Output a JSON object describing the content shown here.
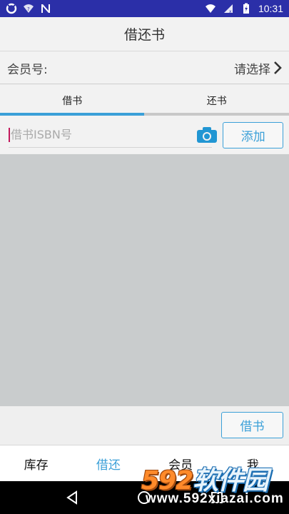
{
  "status_bar": {
    "time": "10:31",
    "icons": [
      "sync-icon",
      "wifi-icon",
      "n-icon",
      "wifi-signal-icon",
      "cell-signal-icon",
      "battery-icon"
    ]
  },
  "header": {
    "title": "借还书"
  },
  "member": {
    "label": "会员号:",
    "value": "请选择"
  },
  "tabs": [
    {
      "label": "借书",
      "active": true
    },
    {
      "label": "还书",
      "active": false
    }
  ],
  "isbn": {
    "placeholder": "借书ISBN号",
    "value": ""
  },
  "actions": {
    "add_label": "添加",
    "borrow_label": "借书"
  },
  "bottom_nav": [
    {
      "label": "库存",
      "active": false
    },
    {
      "label": "借还",
      "active": true
    },
    {
      "label": "会员",
      "active": false
    },
    {
      "label": "我",
      "active": false
    }
  ],
  "watermark": {
    "brand_num": "592",
    "brand_text": "软件园",
    "url": "www.592xiazai.com"
  },
  "colors": {
    "status_bar": "#2b2fa8",
    "accent": "#3ba0d8",
    "list_bg": "#c9cccd"
  }
}
